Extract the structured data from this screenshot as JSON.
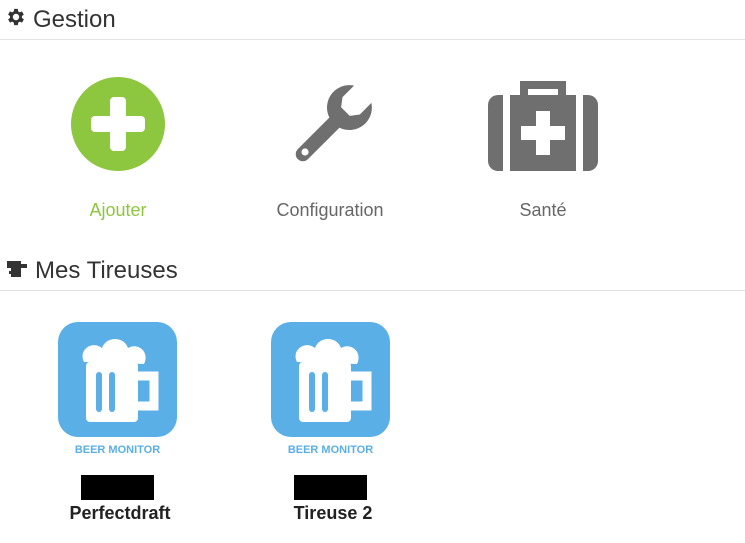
{
  "gestion": {
    "title": "Gestion",
    "icon": "gear-icon",
    "tiles": [
      {
        "label": "Ajouter",
        "icon": "plus-circle-icon",
        "color": "#8dc63f"
      },
      {
        "label": "Configuration",
        "icon": "wrench-icon",
        "color": "#6f6f6f"
      },
      {
        "label": "Santé",
        "icon": "medkit-icon",
        "color": "#6f6f6f"
      }
    ]
  },
  "tireuses": {
    "title": "Mes Tireuses",
    "icon": "beer-tap-icon",
    "items": [
      {
        "name": "Perfectdraft",
        "brand": "BEER MONITOR",
        "icon": "beer-mug-icon"
      },
      {
        "name": "Tireuse 2",
        "brand": "BEER MONITOR",
        "icon": "beer-mug-icon"
      }
    ]
  },
  "colors": {
    "accent_green": "#8dc63f",
    "icon_gray": "#6f6f6f",
    "beer_blue": "#5aafe6"
  }
}
